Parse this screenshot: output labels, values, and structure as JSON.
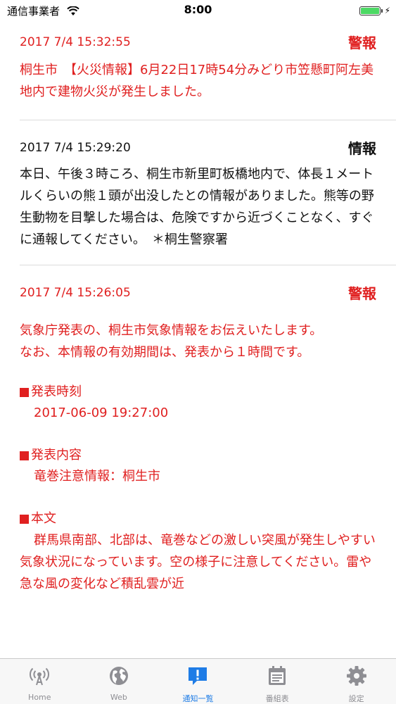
{
  "status": {
    "carrier": "通信事業者",
    "time": "8:00",
    "battery_level": 1.0,
    "bolt": "⚡"
  },
  "items": [
    {
      "timestamp": "2017 7/4 15:32:55",
      "level": "警報",
      "color": "#e02020",
      "text": "桐生市　【火災情報】6月22日17時54分みどり市笠懸町阿左美地内で建物火災が発生しました。"
    },
    {
      "timestamp": "2017 7/4 15:29:20",
      "level": "情報",
      "color": "#111111",
      "text": "本日、午後３時ころ、桐生市新里町板橋地内で、体長１メートルくらいの熊１頭が出没したとの情報がありました。熊等の野生動物を目撃した場合は、危険ですから近づくことなく、すぐに通報してください。　＊桐生警察署"
    },
    {
      "timestamp": "2017 7/4 15:26:05",
      "level": "警報",
      "color": "#e02020",
      "intro": "気象庁発表の、桐生市気象情報をお伝えいたします。\nなお、本情報の有効期間は、発表から１時間です。",
      "sections": [
        {
          "label": "発表時刻",
          "value": "2017-06-09 19:27:00"
        },
        {
          "label": "発表内容",
          "value": "竜巻注意情報：桐生市"
        },
        {
          "label": "本文",
          "value": "群馬県南部、北部は、竜巻などの激しい突風が発生しやすい気象状況になっています。空の様子に注意してください。雷や急な風の変化など積乱雲が近"
        }
      ]
    }
  ],
  "tabs": [
    {
      "label": "Home",
      "icon": "antenna-icon",
      "active": false
    },
    {
      "label": "Web",
      "icon": "globe-icon",
      "active": false
    },
    {
      "label": "通知一覧",
      "icon": "notification-icon",
      "active": true
    },
    {
      "label": "番組表",
      "icon": "calendar-icon",
      "active": false
    },
    {
      "label": "設定",
      "icon": "gear-icon",
      "active": false
    }
  ],
  "colors": {
    "alert": "#e02020",
    "active_tab": "#1e7ce6",
    "inactive_tab": "#8e8e93"
  }
}
